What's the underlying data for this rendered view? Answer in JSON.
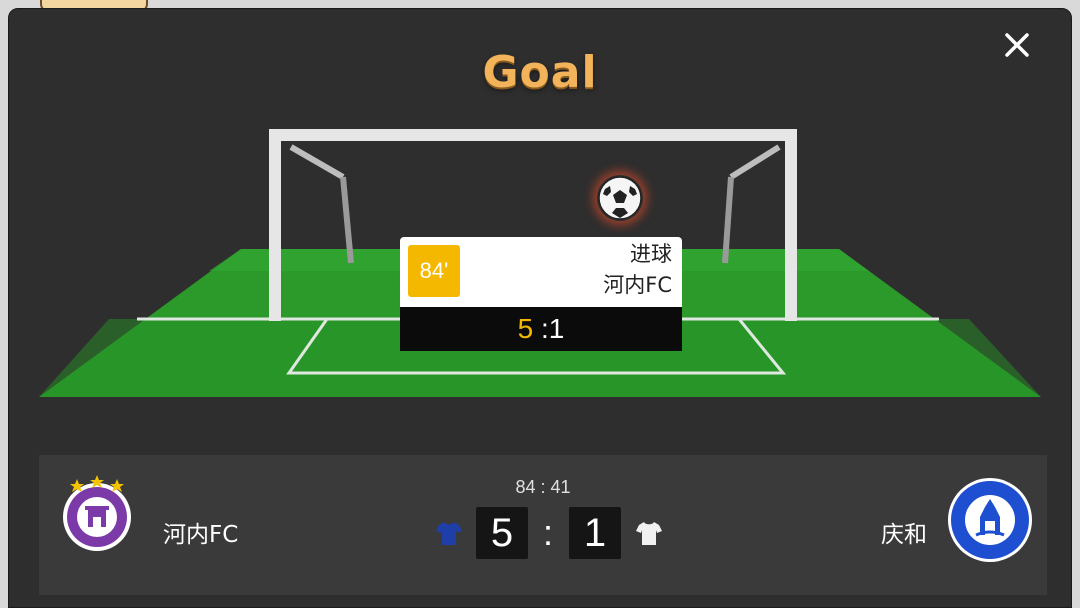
{
  "modal": {
    "title": "Goal",
    "close_icon": "close-icon"
  },
  "event": {
    "minute": "84'",
    "type": "进球",
    "team": "河内FC",
    "score_home": "5",
    "score_separator": " :",
    "score_away": "1"
  },
  "scoreboard": {
    "match_time": "84 : 41",
    "home_team": {
      "name": "河内FC",
      "logo": "hanoi-fc-logo",
      "shirt_color": "#1e3ea8"
    },
    "away_team": {
      "name": "庆和",
      "logo": "khanh-hoa-logo",
      "shirt_color": "#f2f2f2"
    },
    "home_score": "5",
    "separator": ":",
    "away_score": "1"
  },
  "colors": {
    "title": "#f2b35a",
    "minute_badge": "#f5b800",
    "pitch": "#2ea12e",
    "background": "#2e2e2e"
  }
}
